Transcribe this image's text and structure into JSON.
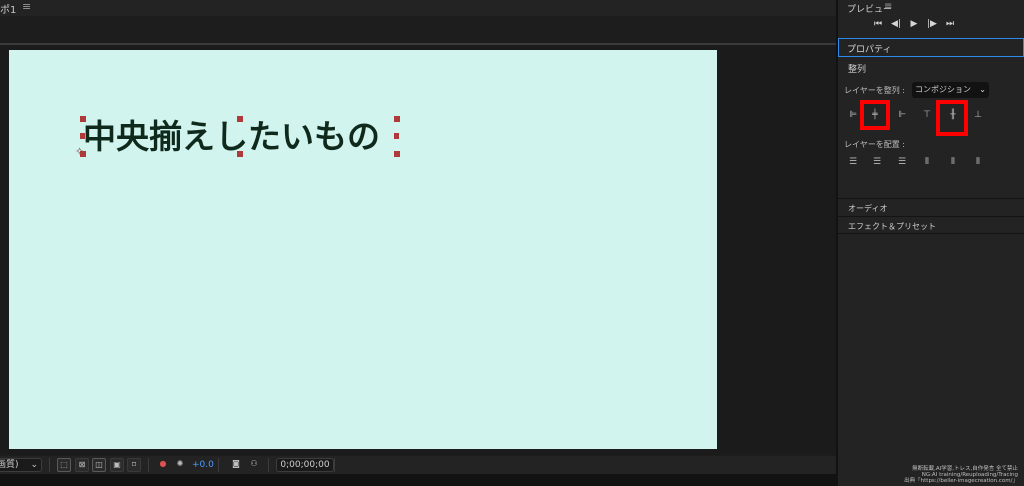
{
  "composition": {
    "tab_label": "ポ1",
    "title_text": "中央揃えしたいもの",
    "canvas_color": "#d2f4ee",
    "text_color": "#0f2a1c"
  },
  "viewer_toolbar": {
    "quality_value": "画質)",
    "exposure_value": "+0.0",
    "timecode": "0;00;00;00"
  },
  "preview": {
    "title": "プレビュー"
  },
  "properties": {
    "title": "プロパティ"
  },
  "align": {
    "title": "整列",
    "align_layers_label": "レイヤーを整列 :",
    "align_target": "コンポジション",
    "distribute_label": "レイヤーを配置 :"
  },
  "sections": {
    "audio": "オーディオ",
    "effects": "エフェクト＆プリセット"
  },
  "watermark": {
    "line1": "無断転載,AI学習,トレス,自作発言 全て禁止",
    "line2": "NG:AI training/Reuploading/Tracing",
    "line3": "出典「https://beller-imagecreation.com/」"
  },
  "colors": {
    "highlight": "#ff0000",
    "accent": "#2d8ceb",
    "exposure": "#4a9bff"
  }
}
